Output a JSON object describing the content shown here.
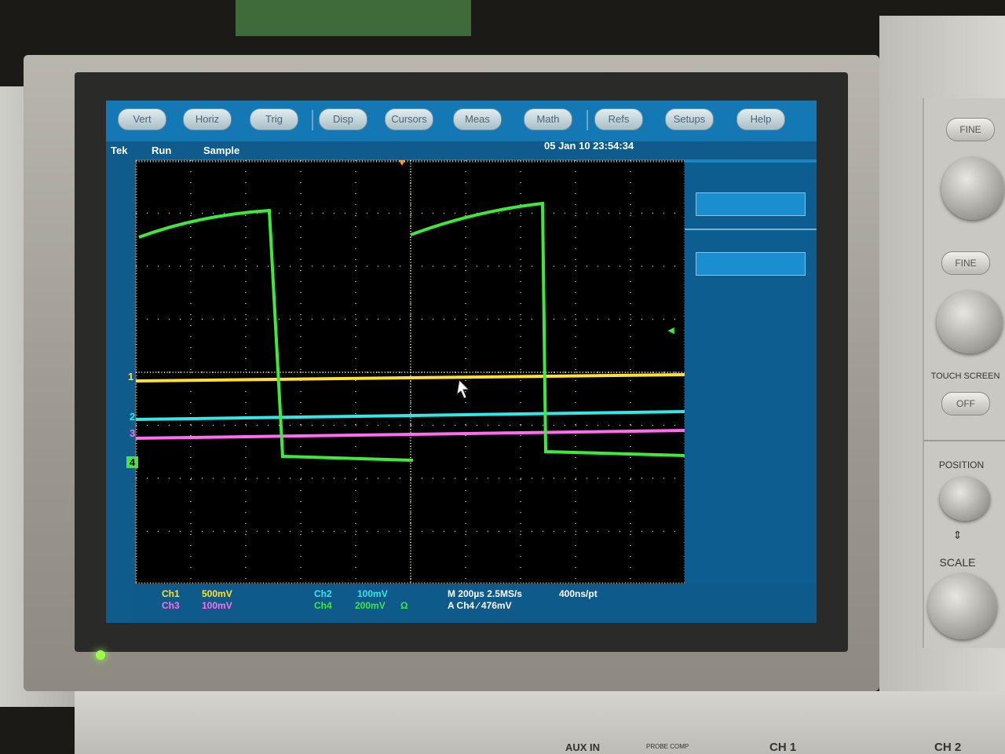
{
  "menu": {
    "vert": "Vert",
    "horiz": "Horiz",
    "trig": "Trig",
    "disp": "Disp",
    "cursors": "Cursors",
    "meas": "Meas",
    "math": "Math",
    "refs": "Refs",
    "setups": "Setups",
    "help": "Help"
  },
  "status": {
    "brand": "Tek",
    "run_state": "Run",
    "acq_mode": "Sample",
    "datetime": "05 Jan 10 23:54:34"
  },
  "channels": {
    "ch1": {
      "name": "Ch1",
      "scale": "500mV",
      "color": "#ffe135",
      "marker": "1"
    },
    "ch2": {
      "name": "Ch2",
      "scale": "100mV",
      "color": "#35e6e6",
      "marker": "2"
    },
    "ch3": {
      "name": "Ch3",
      "scale": "100mV",
      "color": "#ff6cf0",
      "marker": "3"
    },
    "ch4": {
      "name": "Ch4",
      "scale": "200mV",
      "color": "#3fe83a",
      "marker": "4",
      "termination": "Ω"
    }
  },
  "timebase": {
    "horizontal": "M 200µs 2.5MS/s",
    "record": "400ns/pt",
    "trigger": "A Ch4 ∕ 476mV"
  },
  "panel": {
    "fine_1": "FINE",
    "fine_2": "FINE",
    "touch_screen": "TOUCH SCREEN",
    "touch_off": "OFF",
    "position": "POSITION",
    "scale": "SCALE"
  },
  "front": {
    "aux_in": "AUX IN",
    "probe_comp": "PROBE COMP",
    "ch1": "CH 1",
    "ch2": "CH 2"
  },
  "icons": [
    "trigger-position-icon",
    "trigger-level-icon",
    "mouse-cursor-icon",
    "scale-arrows-icon"
  ]
}
